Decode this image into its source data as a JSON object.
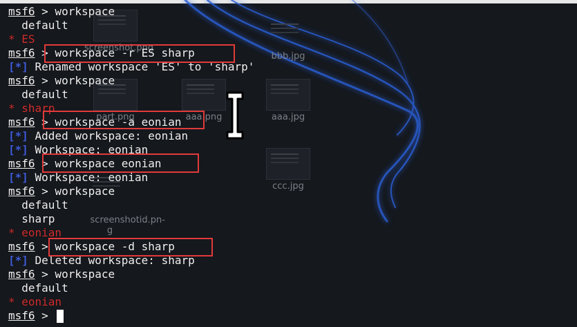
{
  "desktop_icons": [
    {
      "name": "screenshot.png",
      "label": "screenshot.png"
    },
    {
      "name": "bbb.jpg",
      "label": "bbb.jpg"
    },
    {
      "name": "part.png",
      "label": "part.png"
    },
    {
      "name": "aaa.png",
      "label": "aaa.png"
    },
    {
      "name": "aaa.jpg",
      "label": "aaa.jpg"
    },
    {
      "name": "screenshotid.png",
      "label": "screenshotid.pn-\ng"
    },
    {
      "name": "ccc.jpg",
      "label": "ccc.jpg"
    }
  ],
  "terminal": {
    "prompt": "msf6",
    "lines": [
      {
        "kind": "cmd",
        "text": " > workspace"
      },
      {
        "kind": "plain",
        "text": "  default"
      },
      {
        "kind": "current",
        "text": "ES"
      },
      {
        "kind": "cmd",
        "text": " > workspace -r ES sharp"
      },
      {
        "kind": "info",
        "text": " Renamed workspace 'ES' to 'sharp'"
      },
      {
        "kind": "cmd",
        "text": " > workspace"
      },
      {
        "kind": "plain",
        "text": "  default"
      },
      {
        "kind": "current",
        "text": "sharp"
      },
      {
        "kind": "cmd",
        "text": " > workspace -a eonian"
      },
      {
        "kind": "info",
        "text": " Added workspace: eonian"
      },
      {
        "kind": "info",
        "text": " Workspace: eonian"
      },
      {
        "kind": "cmd",
        "text": " > workspace eonian"
      },
      {
        "kind": "info",
        "text": " Workspace: eonian"
      },
      {
        "kind": "cmd",
        "text": " > workspace"
      },
      {
        "kind": "plain",
        "text": "  default"
      },
      {
        "kind": "plain",
        "text": "  sharp"
      },
      {
        "kind": "current",
        "text": "eonian"
      },
      {
        "kind": "cmd",
        "text": " > workspace -d sharp"
      },
      {
        "kind": "info",
        "text": " Deleted workspace: sharp"
      },
      {
        "kind": "cmd",
        "text": " > workspace"
      },
      {
        "kind": "plain",
        "text": "  default"
      },
      {
        "kind": "current",
        "text": "eonian"
      },
      {
        "kind": "cmd",
        "text": " > "
      }
    ],
    "info_tag": "[*]",
    "current_marker": "* "
  },
  "colors": {
    "background": "#15181d",
    "text": "#f2f2f2",
    "current_workspace": "#d22f2f",
    "info_tag": "#3f5cd8",
    "highlight_box": "#e23a3a",
    "swirl": "#2b5fd6"
  },
  "icons": {
    "text_cursor": "i-beam-cursor-icon"
  }
}
